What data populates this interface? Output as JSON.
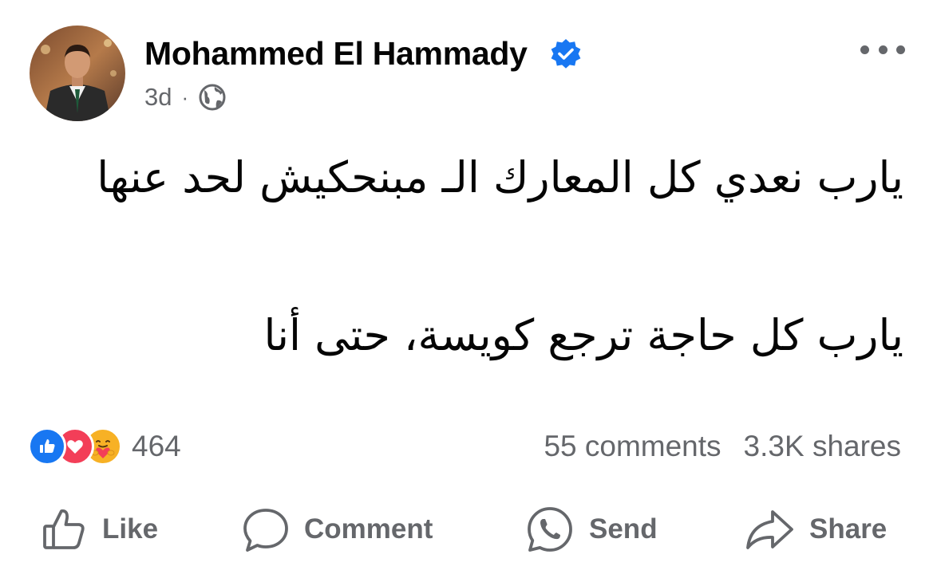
{
  "post": {
    "author": "Mohammed El Hammady",
    "time": "3d",
    "separator": "·",
    "verified_icon": "verified-badge-icon",
    "privacy_icon": "globe-icon",
    "text_line1": "يارب نعدي كل المعارك الـ مبنحكيش لحد عنها",
    "text_line2": "يارب كل حاجة ترجع كويسة، حتى أنا"
  },
  "stats": {
    "reaction_icons": [
      "like-reaction-icon",
      "love-reaction-icon",
      "care-reaction-icon"
    ],
    "reactions_count": "464",
    "comments": "55 comments",
    "shares": "3.3K shares"
  },
  "actions": {
    "like": "Like",
    "comment": "Comment",
    "send": "Send",
    "share": "Share"
  },
  "colors": {
    "verified_blue": "#1877f2",
    "secondary_text": "#65676b",
    "like_blue": "#1877f2",
    "love_red": "#f33e58",
    "care_yellow": "#f7b125"
  }
}
